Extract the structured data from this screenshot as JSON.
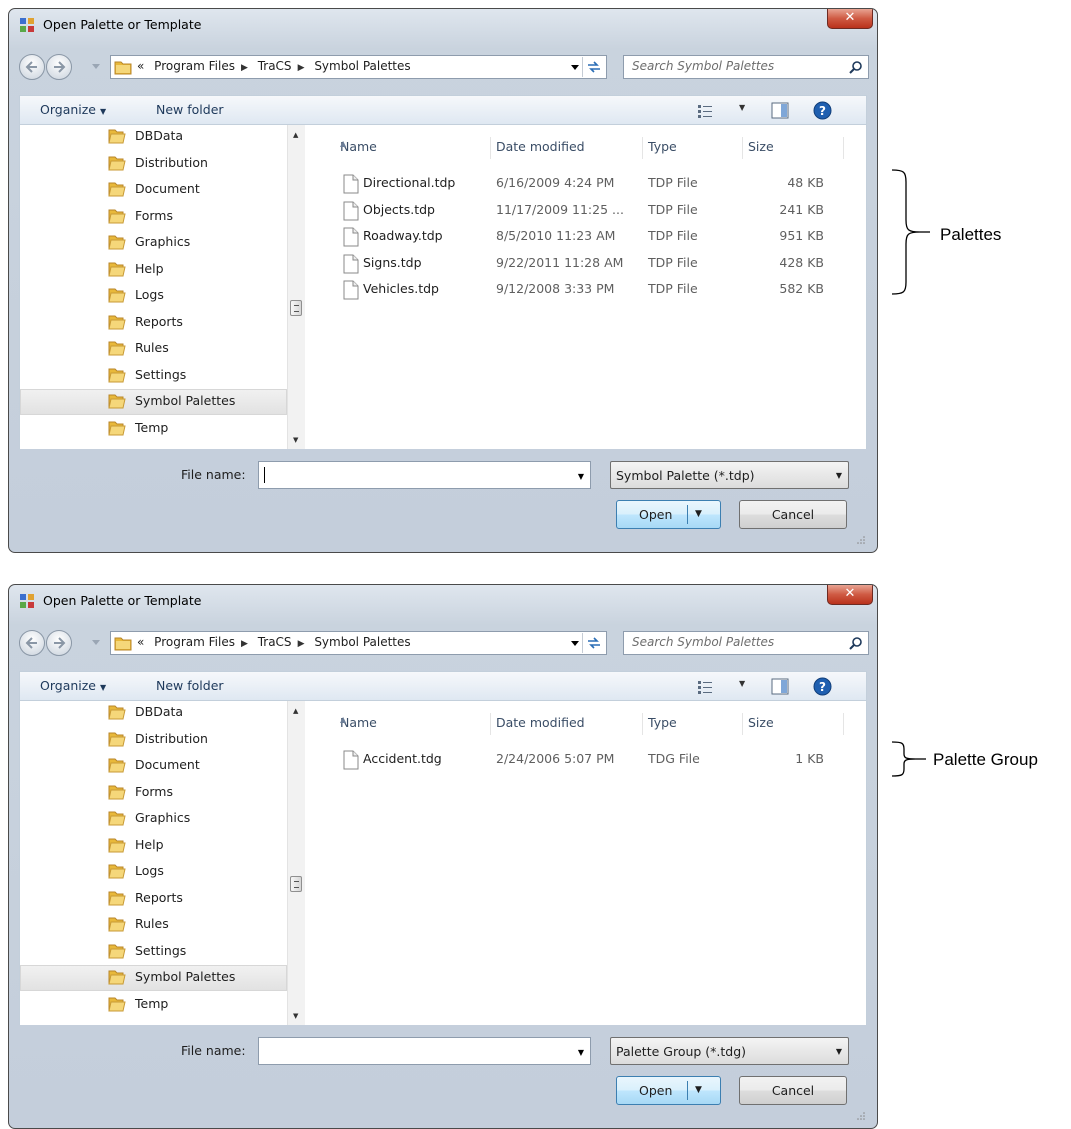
{
  "dialogs": [
    {
      "title": "Open Palette or Template",
      "breadcrumb": {
        "chevron": "«",
        "parts": [
          "Program Files",
          "TraCS",
          "Symbol Palettes"
        ]
      },
      "search_placeholder": "Search Symbol Palettes",
      "toolbar": {
        "organize": "Organize",
        "new_folder": "New folder"
      },
      "tree": [
        "DBData",
        "Distribution",
        "Document",
        "Forms",
        "Graphics",
        "Help",
        "Logs",
        "Reports",
        "Rules",
        "Settings",
        "Symbol Palettes",
        "Temp"
      ],
      "selected_folder": "Symbol Palettes",
      "columns": {
        "name": "Name",
        "date": "Date modified",
        "type": "Type",
        "size": "Size"
      },
      "files": [
        {
          "name": "Directional.tdp",
          "date": "6/16/2009 4:24 PM",
          "type": "TDP File",
          "size": "48 KB"
        },
        {
          "name": "Objects.tdp",
          "date": "11/17/2009 11:25 ...",
          "type": "TDP File",
          "size": "241 KB"
        },
        {
          "name": "Roadway.tdp",
          "date": "8/5/2010 11:23 AM",
          "type": "TDP File",
          "size": "951 KB"
        },
        {
          "name": "Signs.tdp",
          "date": "9/22/2011 11:28 AM",
          "type": "TDP File",
          "size": "428 KB"
        },
        {
          "name": "Vehicles.tdp",
          "date": "9/12/2008 3:33 PM",
          "type": "TDP File",
          "size": "582 KB"
        }
      ],
      "file_name_label": "File name:",
      "file_name_value": "",
      "filter": "Symbol Palette (*.tdp)",
      "open_label": "Open",
      "cancel_label": "Cancel",
      "annotation": "Palettes"
    },
    {
      "title": "Open Palette or Template",
      "breadcrumb": {
        "chevron": "«",
        "parts": [
          "Program Files",
          "TraCS",
          "Symbol Palettes"
        ]
      },
      "search_placeholder": "Search Symbol Palettes",
      "toolbar": {
        "organize": "Organize",
        "new_folder": "New folder"
      },
      "tree": [
        "DBData",
        "Distribution",
        "Document",
        "Forms",
        "Graphics",
        "Help",
        "Logs",
        "Reports",
        "Rules",
        "Settings",
        "Symbol Palettes",
        "Temp"
      ],
      "selected_folder": "Symbol Palettes",
      "columns": {
        "name": "Name",
        "date": "Date modified",
        "type": "Type",
        "size": "Size"
      },
      "files": [
        {
          "name": "Accident.tdg",
          "date": "2/24/2006 5:07 PM",
          "type": "TDG File",
          "size": "1 KB"
        }
      ],
      "file_name_label": "File name:",
      "file_name_value": "",
      "filter": "Palette Group (*.tdg)",
      "open_label": "Open",
      "cancel_label": "Cancel",
      "annotation": "Palette Group"
    }
  ],
  "icons": {
    "app": "palette-app-icon",
    "close": "close-icon",
    "back": "back-arrow-icon",
    "forward": "forward-arrow-icon",
    "folder": "folder-icon",
    "refresh": "refresh-icon",
    "search": "search-icon",
    "views": "view-options-icon",
    "preview": "preview-pane-icon",
    "help": "help-icon",
    "file": "file-icon"
  },
  "colors": {
    "folder": "#e8b83a",
    "titlebar": "#dfe6ee",
    "close": "#c7432b",
    "open_button": "#bee6fd",
    "help": "#1f5fb0"
  }
}
